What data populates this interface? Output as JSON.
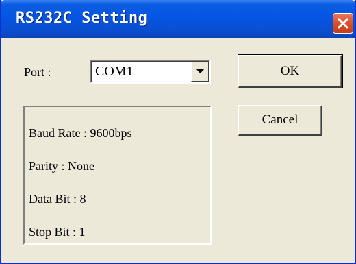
{
  "window": {
    "title": "RS232C Setting"
  },
  "port": {
    "label": "Port :",
    "selected": "COM1"
  },
  "buttons": {
    "ok": "OK",
    "cancel": "Cancel"
  },
  "settings": {
    "baud_rate": "Baud Rate : 9600bps",
    "parity": "Parity : None",
    "data_bit": "Data Bit : 8",
    "stop_bit": "Stop Bit : 1"
  },
  "icons": {
    "close": "close-icon",
    "dropdown": "dropdown-arrow-icon"
  },
  "colors": {
    "titlebar": "#0554e3",
    "close_button": "#d9532f",
    "dialog_bg": "#ece9d8"
  }
}
